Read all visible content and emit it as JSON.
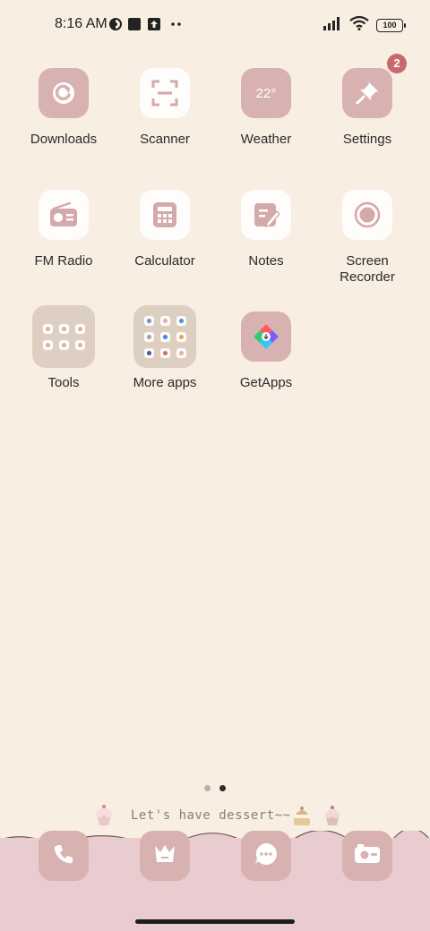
{
  "status_bar": {
    "time": "8:16 AM",
    "battery": "100",
    "icons": [
      "data-saver-icon",
      "square-notification-icon",
      "upload-icon",
      "more-dots-icon",
      "signal-icon",
      "wifi-icon",
      "battery-icon"
    ]
  },
  "apps": [
    {
      "label": "Downloads",
      "icon": "downloads-icon"
    },
    {
      "label": "Scanner",
      "icon": "scanner-icon"
    },
    {
      "label": "Weather",
      "icon": "weather-icon",
      "icon_text": "22°"
    },
    {
      "label": "Settings",
      "icon": "settings-icon",
      "badge": "2"
    },
    {
      "label": "FM Radio",
      "icon": "radio-icon"
    },
    {
      "label": "Calculator",
      "icon": "calculator-icon"
    },
    {
      "label": "Notes",
      "icon": "notes-icon"
    },
    {
      "label": "Screen Recorder",
      "icon": "screen-recorder-icon"
    },
    {
      "label": "Tools",
      "icon": "folder-icon"
    },
    {
      "label": "More apps",
      "icon": "folder-icon"
    },
    {
      "label": "GetApps",
      "icon": "getapps-icon"
    }
  ],
  "pages": {
    "count": 2,
    "active": 2
  },
  "tagline": "Let's have dessert~~",
  "dock": [
    {
      "icon": "phone-icon"
    },
    {
      "icon": "store-icon"
    },
    {
      "icon": "messages-icon"
    },
    {
      "icon": "camera-icon"
    }
  ],
  "colors": {
    "background": "#f8eee2",
    "icon_pink": "#d8b1b1",
    "dock": "#e8ccd0",
    "badge": "#c86a6d"
  }
}
